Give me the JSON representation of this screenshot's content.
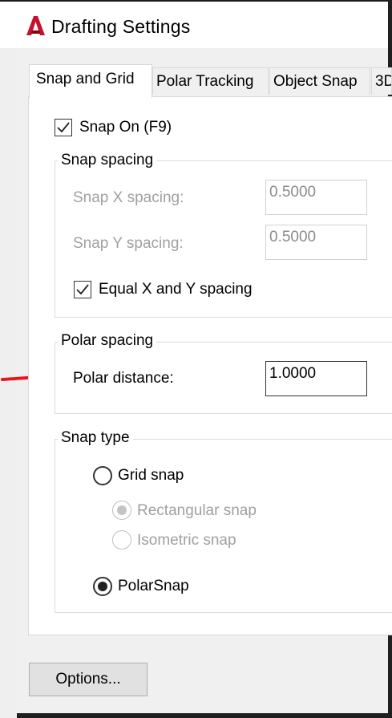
{
  "window": {
    "title": "Drafting Settings",
    "icon": "autocad-logo-icon"
  },
  "tabs": [
    {
      "label": "Snap and Grid",
      "active": true
    },
    {
      "label": "Polar Tracking",
      "active": false
    },
    {
      "label": "Object Snap",
      "active": false
    },
    {
      "label": "3D",
      "active": false
    }
  ],
  "snap_on": {
    "label": "Snap On (F9)",
    "checked": true
  },
  "snap_spacing": {
    "group_label": "Snap spacing",
    "x_label": "Snap X spacing:",
    "x_value": "0.5000",
    "y_label": "Snap Y spacing:",
    "y_value": "0.5000",
    "equal_label": "Equal X and Y spacing",
    "equal_checked": true
  },
  "polar_spacing": {
    "group_label": "Polar spacing",
    "distance_label": "Polar distance:",
    "distance_value": "1.0000"
  },
  "snap_type": {
    "group_label": "Snap type",
    "grid_snap_label": "Grid snap",
    "rectangular_label": "Rectangular snap",
    "isometric_label": "Isometric snap",
    "polar_snap_label": "PolarSnap",
    "selected": "PolarSnap"
  },
  "buttons": {
    "options_label": "Options..."
  },
  "annotations": {
    "arrow_color": "#e8141b"
  }
}
